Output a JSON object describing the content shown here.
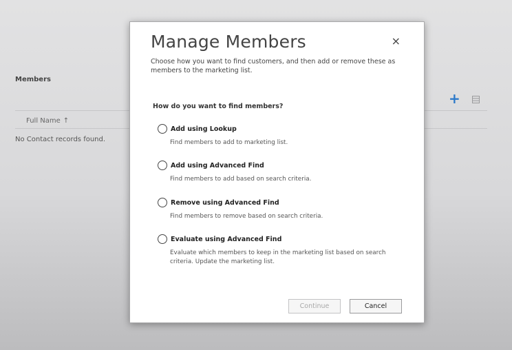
{
  "background": {
    "section_title": "Members",
    "column_header": "Full Name",
    "sort_arrow": "↑",
    "empty_message": "No Contact records found.",
    "add_icon": "plus-icon",
    "grid_icon": "grid-view-icon"
  },
  "dialog": {
    "title": "Manage Members",
    "close_glyph": "×",
    "subtitle": "Choose how you want to find customers, and then add or remove these as members to the marketing list.",
    "question": "How do you want to find members?",
    "options": [
      {
        "label": "Add using Lookup",
        "description": "Find members to add to marketing list."
      },
      {
        "label": "Add using Advanced Find",
        "description": "Find members to add based on search criteria."
      },
      {
        "label": "Remove using Advanced Find",
        "description": "Find members to remove based on search criteria."
      },
      {
        "label": "Evaluate using Advanced Find",
        "description": "Evaluate which members to keep in the marketing list based on search criteria. Update the marketing list."
      }
    ],
    "continue_label": "Continue",
    "cancel_label": "Cancel"
  },
  "colors": {
    "accent": "#2c79c9",
    "dialog_bg": "#ffffff",
    "disabled_text": "#a8a8a8"
  }
}
